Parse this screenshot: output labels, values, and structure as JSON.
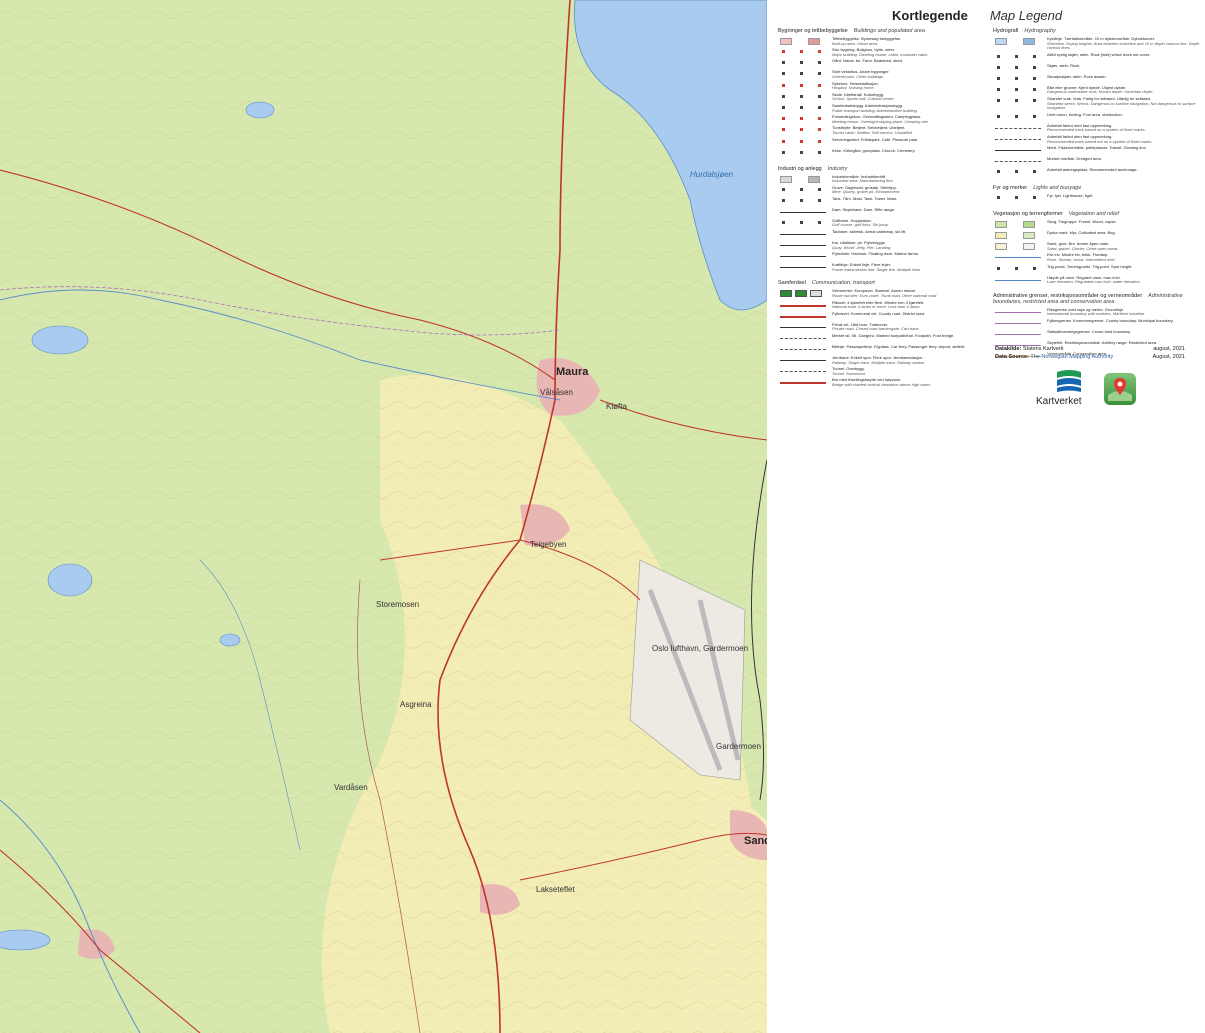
{
  "legend": {
    "title": "Kortlegende",
    "title_en": "Map Legend",
    "sections": [
      {
        "id": "buildings",
        "title": "Bygninger og tettbebyggelse",
        "title_en": "Buildings and populated area",
        "column": "left",
        "items": [
          {
            "text": "Tettbebyggelse. Bymessig bebyggelse.",
            "en": "Built-up area. Urban area.",
            "symbol": "area-pink"
          },
          {
            "text": "Stor bygning. Bolighus, hytte, seter.",
            "en": "Major building. Dwelling house, cabin, mountain cabin.",
            "symbol": "dots-red"
          },
          {
            "text": "Gård. Naust, bu.  Farm. Boatshed, shed.",
            "en": "",
            "symbol": "dots-black"
          },
          {
            "text": "Stort veksthus. Andre bygninger.",
            "en": "Greenhouse. Other buildings.",
            "symbol": "dots-black"
          },
          {
            "text": "Sykehus. Helseinstitusjon.",
            "en": "Hospital. Nursing home.",
            "symbol": "dots-red"
          },
          {
            "text": "Skole. Idrettshall. Kulturbygg.",
            "en": "School. Sports hall. Cultural centre.",
            "symbol": "dots-black"
          },
          {
            "text": "Samferdselsbygg. Administrasjonsbygg.",
            "en": "Public transport building. Administrative building.",
            "symbol": "dots-black"
          },
          {
            "text": "Forsamlingshus. Overnattingssted. Campingplass.",
            "en": "Meeting house. Overnight staying place. Camping site.",
            "symbol": "dots-red"
          },
          {
            "text": "Turisthytte: Betjent. Selvbetjent. Ubetjent.",
            "en": "Tourist cabin: Staffed. Self-service. Unstaffed.",
            "symbol": "dots-red"
          },
          {
            "text": "Serveringssted. Fritidspark.  Café. Pleasure park.",
            "en": "",
            "symbol": "dots-red"
          },
          {
            "text": "Kirke. Kirkegård, gravplass.  Church. Cemetery.",
            "en": "",
            "symbol": "dots-black"
          }
        ]
      },
      {
        "id": "industry",
        "title": "Industri og anlegg",
        "title_en": "Industry",
        "column": "left",
        "items": [
          {
            "text": "Industriområde. Industribedrift.",
            "en": "Industrial area. Manufacturing firm.",
            "symbol": "area-grey"
          },
          {
            "text": "Gruve. Dagbrudd, grustak. Steintipp.",
            "en": "Mine. Quarry, gravel pit. Embankment.",
            "symbol": "dots-black"
          },
          {
            "text": "Tank. Tårn. Mast.  Tank. Tower. Mast.",
            "en": "",
            "symbol": "dots-black"
          },
          {
            "text": "Dam. Skytebane.  Dam. Rifle range.",
            "en": "",
            "symbol": "line-black"
          },
          {
            "text": "Golfbane. Hoppbakke.",
            "en": "Golf course, golf links. Ski jump.",
            "symbol": "dots-black"
          },
          {
            "text": "Taubane, skitrekk.  Aerial cableway, ski lift.",
            "en": "",
            "symbol": "line-black"
          },
          {
            "text": "Kai. Utstikker, pir. Flytebrygge.",
            "en": "Quay. Wharf. Jetty, Pier. Landing.",
            "symbol": "line-black"
          },
          {
            "text": "Flytedokk. Havbruk.  Floating dock. Marine farms.",
            "en": "",
            "symbol": "line-black"
          },
          {
            "text": "Kraftlinje: Enkelt linje. Flere linjer.",
            "en": "Power transmission line: Single line. Multiple lines.",
            "symbol": "line-black"
          }
        ]
      },
      {
        "id": "transport",
        "title": "Samferdsel",
        "title_en": "Communication, transport",
        "column": "left",
        "items": [
          {
            "text": "Veinummer: Europavei. Stamvei. Annen riksvei.",
            "en": "Route number: Euro-route. Trunk road. Other national road.",
            "symbol": "route-badges"
          },
          {
            "text": "Riksvei: 4 kjørefelt eller flere. Mindre enn 4 kjørefelt.",
            "en": "National road: 4 lanes or more. Less than 4 lanes.",
            "symbol": "line-red"
          },
          {
            "text": "Fylkesvei. Kommunal vei.  County road. District road.",
            "en": "",
            "symbol": "line-red"
          },
          {
            "text": "Privat vei. Låst bom. Traktorvei.",
            "en": "Private road. Closed road barrier/gate. Cart track.",
            "symbol": "line-black"
          },
          {
            "text": "Merket sti. Sti. Gangbru.  Marked footpath/trail. Footpath. Foot bridge.",
            "en": "",
            "symbol": "line-dash"
          },
          {
            "text": "Bilferje. Passasjerferje. Flyplass.  Car ferry. Passenger ferry. Airport, airfield.",
            "en": "",
            "symbol": "line-dash"
          },
          {
            "text": "Jernbane: Enkelt spor. Flere spor. Jernbanestasjon.",
            "en": "Railway: Single track. Multiple track. Railway station.",
            "symbol": "line-black"
          },
          {
            "text": "Tunnel. Overbygg.",
            "en": "Tunnel. Snowshed.",
            "symbol": "line-dash"
          },
          {
            "text": "Bru med friseilingshøyde ved høyvann.",
            "en": "Bridge with charted vertical clearance above high water.",
            "symbol": "line-red"
          }
        ]
      },
      {
        "id": "hydrography",
        "title": "Hydrografi",
        "title_en": "Hydrography",
        "column": "right",
        "items": [
          {
            "text": "Kystlinje. Tørrfalleområde. 10 m dybdeområde. Dybdekurver.",
            "en": "Shoreline. Drying heights. Area between shoreline and 10 m depth contour line. Depth contour lines.",
            "symbol": "area-blue"
          },
          {
            "text": "Alltid synlig skjær, stein.  Rock (islet) which does not cover.",
            "en": "",
            "symbol": "dots-black"
          },
          {
            "text": "Skjær, stein.  Rock.",
            "en": "",
            "symbol": "dots-black"
          },
          {
            "text": "Skvalpeskjær, stein.  Rock awash.",
            "en": "",
            "symbol": "dots-black"
          },
          {
            "text": "Båe eller grunne: Kjent dybde. Ukjent dybde.",
            "en": "Dangerous underwater rock: Known depth. Uncertain depth.",
            "symbol": "dots-black"
          },
          {
            "text": "Strandet vrak. Vrak. Farlig for seilasen. Ufarlig for seilasen.",
            "en": "Stranded wreck. Wreck. Dangerous to surface navigation. Not dangerous to surface navigation.",
            "symbol": "dots-black"
          },
          {
            "text": "Urein bunn, bnding.  Foul area, obstruction.",
            "en": "",
            "symbol": "dots-black"
          },
          {
            "text": "Anbefalt farled med fast oppmerking.",
            "en": "Recommended track based on a system of fixed marks.",
            "symbol": "line-dash"
          },
          {
            "text": "Anbefalt farled uten fast oppmerking.",
            "en": "Recommended track based not on a system of fixed marks.",
            "symbol": "line-dash"
          },
          {
            "text": "Merd. Fiskeriområde, pelleplassnr.  Transit. Clearing line.",
            "en": "",
            "symbol": "line-black"
          },
          {
            "text": "Mudret område.  Dredged area.",
            "en": "",
            "symbol": "line-dash"
          },
          {
            "text": "Anbefalt ankringsplass.  Recommended anchorage.",
            "en": "",
            "symbol": "dots-black"
          }
        ]
      },
      {
        "id": "lights",
        "title": "Fyr og merker",
        "title_en": "Lights and buoyage",
        "column": "right",
        "items": [
          {
            "text": "Fyr, lykt.  Lighthouse, light.",
            "en": "",
            "symbol": "dots-black"
          }
        ]
      },
      {
        "id": "vegetation",
        "title": "Vegetasjon og terrengformer",
        "title_en": "Vegetation and relief",
        "column": "right",
        "items": [
          {
            "text": "Skog. Tregruppe.  Forest. Wood, copse.",
            "en": "",
            "symbol": "area-green"
          },
          {
            "text": "Dyrka mark. Myr.  Cultivated area. Bog.",
            "en": "",
            "symbol": "area-yellow"
          },
          {
            "text": "Sand, grus. Bre. Annen åpen mark.",
            "en": "Sand, gravel. Glacier. Other open areas.",
            "symbol": "area-light"
          },
          {
            "text": "Elvi elv. Mindre elv, bekk. Flomløp.",
            "en": "River. Stream, brook. Intermittent river.",
            "symbol": "line-blue"
          },
          {
            "text": "Trig.punkt. Terrengpunkt.  Trig.point. Spot height.",
            "en": "",
            "symbol": "dots-black"
          },
          {
            "text": "Høyde på vann. Regulert vann, max./min.",
            "en": "Lake elevation. Regulated max./min. water elevation.",
            "symbol": "line-blue"
          }
        ]
      },
      {
        "id": "admin",
        "title": "Administrative grenser, restriksjonsområder og verneområder",
        "title_en": "Administrative boundaries, restricted area and conservation area",
        "column": "right",
        "items": [
          {
            "text": "Riksgrense med røys og merke. Grunnlinje.",
            "en": "International boundary with markers. Maritime baseline.",
            "symbol": "line-purple"
          },
          {
            "text": "Fylkesgrense. Kommunegrense.  County boundary. Municipal boundary.",
            "en": "",
            "symbol": "line-purple"
          },
          {
            "text": "Statsallmenningsgrense.  Crown land boundary.",
            "en": "",
            "symbol": "line-purple"
          },
          {
            "text": "Skytefelt. Restriksjonsområde.  Artillery range. Restricted area.",
            "en": "",
            "symbol": "line-purple"
          },
          {
            "text": "Verneområde.  Conservation area.",
            "en": "",
            "symbol": "line-orange"
          }
        ]
      }
    ]
  },
  "source": {
    "nb_label": "Datakilde:",
    "nb_value": "Statens Kartverk",
    "nb_date": "august, 2021",
    "en_label": "Data Source:",
    "en_value": "The Norwegian Mapping Authority",
    "en_date": "August, 2021",
    "logo_text": "Kartverket"
  },
  "map": {
    "places": [
      {
        "name": "Maura",
        "class": "big",
        "key": "maura"
      },
      {
        "name": "Hurdalsjøen",
        "class": "water",
        "key": "lake"
      },
      {
        "name": "Kløfta",
        "class": "",
        "key": "klofta"
      },
      {
        "name": "Oslo lufthavn, Gardermoen",
        "class": "",
        "key": "airport"
      },
      {
        "name": "Gardermoen",
        "class": "",
        "key": "gardermoen"
      },
      {
        "name": "Sand",
        "class": "big",
        "key": "sand"
      },
      {
        "name": "Lakseteflet",
        "class": "",
        "key": "lak"
      },
      {
        "name": "Asgreina",
        "class": "",
        "key": "asgreina"
      },
      {
        "name": "Vardåsen",
        "class": "",
        "key": "vardasen"
      },
      {
        "name": "Storemosen",
        "class": "",
        "key": "storemosen"
      },
      {
        "name": "Teigebyen",
        "class": "",
        "key": "teigebyen"
      },
      {
        "name": "Vålsåsen",
        "class": "",
        "key": "valsasen"
      }
    ]
  }
}
